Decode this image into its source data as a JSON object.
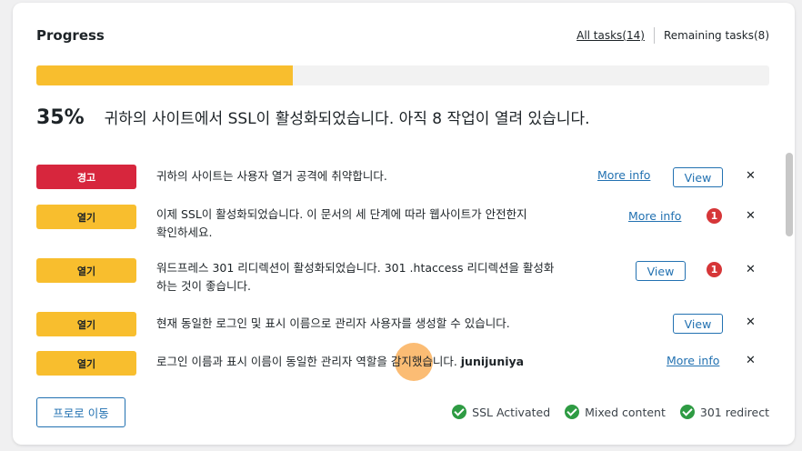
{
  "header": {
    "title": "Progress",
    "tab_all": "All tasks(14)",
    "tab_remaining": "Remaining tasks(8)"
  },
  "progress": {
    "value_fraction": 0.35,
    "percent_label": "35%",
    "message": "귀하의 사이트에서 SSL이 활성화되었습니다. 아직 8 작업이 열려 있습니다."
  },
  "tasks": [
    {
      "badge": "경고",
      "text_line1": "귀하의 사이트는 사용자 열거 공격에 취약합니다.",
      "more": "More info",
      "view": "View"
    },
    {
      "badge": "열기",
      "text_line1": "이제 SSL이 활성화되었습니다. 이 문서의 세 단계에 따라 웹사이트가 안전한지",
      "text_line2": "확인하세요.",
      "more": "More info",
      "notice": "1"
    },
    {
      "badge": "열기",
      "text_line1": "워드프레스 301 리디렉션이 활성화되었습니다. 301 .htaccess 리디렉션을 활성화",
      "text_line2": "하는 것이 좋습니다.",
      "view": "View",
      "notice": "1"
    },
    {
      "badge": "열기",
      "text_line1": "현재 동일한 로그인 및 표시 이름으로 관리자 사용자를 생성할 수 있습니다.",
      "view": "View"
    },
    {
      "badge": "열기",
      "text_line1": "로그인 이름과 표시 이름이 동일한 관리자 역할을 감지했습니다. ",
      "text_bold": "junijuniya",
      "more": "More info"
    }
  ],
  "footer": {
    "button": "프로로 이동",
    "statuses": [
      "SSL Activated",
      "Mixed content",
      "301 redirect"
    ]
  },
  "colors": {
    "accent": "#2271b1",
    "progress": "#f8be2e",
    "warning": "#d7263d",
    "success": "#2e9b43"
  },
  "icons": [
    "close-icon",
    "notice-icon",
    "check-circle-icon"
  ]
}
